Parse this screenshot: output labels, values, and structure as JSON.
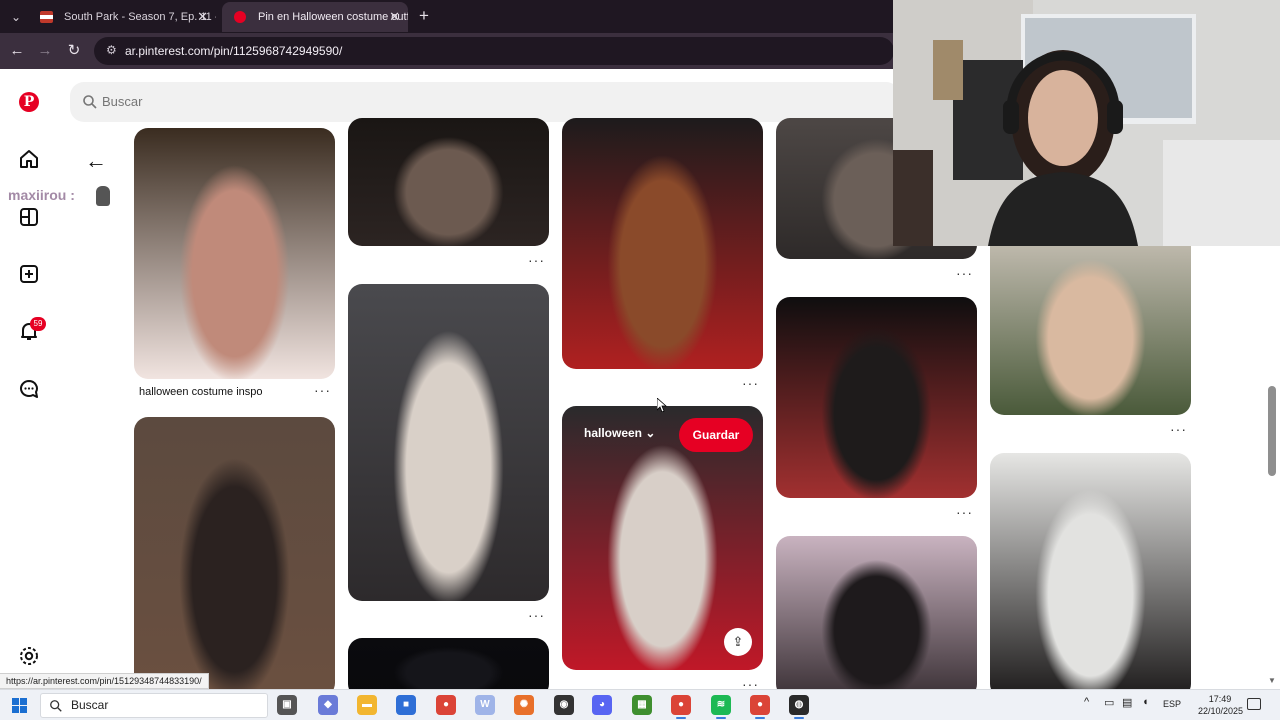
{
  "browser": {
    "tabs": [
      {
        "title": "South Park - Season 7, Ep. 11 -",
        "close": "✕",
        "icon": "tv-favicon-icon",
        "active": false
      },
      {
        "title": "Pin en Halloween costume outf",
        "close": "✕",
        "icon": "pinterest-favicon-icon",
        "active": true
      }
    ],
    "new_tab": "+",
    "url": "ar.pinterest.com/pin/1125968742949590/"
  },
  "pinterest": {
    "search_placeholder": "Buscar",
    "notification_count": "59",
    "back_icon": "arrow-left-icon",
    "overlay_username": "maxiirou :",
    "pins": [
      {
        "id": "c1a",
        "caption": "halloween costume inspo",
        "more": "···",
        "colors": [
          "#3a2c20",
          "#c08a7a",
          "#f1e4e0"
        ]
      },
      {
        "id": "c1b",
        "caption": "",
        "more": "",
        "colors": [
          "#5c4a3f",
          "#2b2220",
          "#6b5040"
        ]
      },
      {
        "id": "c2a",
        "caption": "",
        "more": "···",
        "colors": [
          "#1a1614",
          "#6c5a50",
          "#2c2422"
        ]
      },
      {
        "id": "c2b",
        "caption": "",
        "more": "···",
        "colors": [
          "#4a4a4e",
          "#d9d0c8",
          "#2d2a2c"
        ]
      },
      {
        "id": "c2c",
        "caption": "",
        "more": "",
        "colors": [
          "#0b0b0e",
          "#15151a",
          "#09090c"
        ]
      },
      {
        "id": "c3a",
        "caption": "",
        "more": "···",
        "colors": [
          "#1d1b1c",
          "#8a4a2a",
          "#b02020"
        ]
      },
      {
        "id": "c3b",
        "caption": "",
        "more": "···",
        "colors": [
          "#2a2a2c",
          "#d8cfc8",
          "#c01828"
        ]
      },
      {
        "id": "c4a",
        "caption": "",
        "more": "···",
        "colors": [
          "#4d4745",
          "#6b5f58",
          "#2e2a29"
        ]
      },
      {
        "id": "c4b",
        "caption": "",
        "more": "···",
        "colors": [
          "#0f0e0f",
          "#1e1b1b",
          "#a23030"
        ]
      },
      {
        "id": "c4c",
        "caption": "",
        "more": "",
        "colors": [
          "#c9b3c0",
          "#1e1a1c",
          "#3a3035"
        ]
      },
      {
        "id": "c5a",
        "caption": "",
        "more": "···",
        "colors": [
          "#c7c0b5",
          "#d9b9a0",
          "#4a5a3a"
        ]
      },
      {
        "id": "c5b",
        "caption": "",
        "more": "",
        "colors": [
          "#e6e6e4",
          "#e2e2e0",
          "#1c1a1a"
        ]
      }
    ],
    "hover_board_label": "halloween",
    "hover_board_chevron": "⌄",
    "save_button": "Guardar",
    "share_icon": "share-icon"
  },
  "status_bar_url": "https://ar.pinterest.com/pin/15129348744833190/",
  "taskbar": {
    "search_placeholder": "Buscar",
    "apps": [
      {
        "name": "task-view-icon",
        "glyph": "▣",
        "color": "#555555"
      },
      {
        "name": "copilot-icon",
        "glyph": "◆",
        "color": "#6a7bd8"
      },
      {
        "name": "file-explorer-icon",
        "glyph": "▬",
        "color": "#f2b630"
      },
      {
        "name": "microsoft-store-icon",
        "glyph": "■",
        "color": "#2f6fd6"
      },
      {
        "name": "chrome-icon",
        "glyph": "●",
        "color": "#db4437"
      },
      {
        "name": "word-icon",
        "glyph": "W",
        "color": "#9fb4e8"
      },
      {
        "name": "sun-app-icon",
        "glyph": "✺",
        "color": "#e8702a"
      },
      {
        "name": "obs-icon",
        "glyph": "◉",
        "color": "#333333"
      },
      {
        "name": "discord-icon",
        "glyph": "◕",
        "color": "#5865f2"
      },
      {
        "name": "minecraft-icon",
        "glyph": "▦",
        "color": "#3f8f2f"
      },
      {
        "name": "chrome-profile-icon",
        "glyph": "●",
        "color": "#db4437"
      },
      {
        "name": "spotify-icon",
        "glyph": "≋",
        "color": "#1db954"
      },
      {
        "name": "chrome-alt-icon",
        "glyph": "●",
        "color": "#db4437"
      },
      {
        "name": "recording-icon",
        "glyph": "◍",
        "color": "#2a2a2a"
      }
    ],
    "tray": {
      "chevron": "^",
      "language": "ESP"
    },
    "time": "17:49",
    "date": "22/10/2025"
  }
}
